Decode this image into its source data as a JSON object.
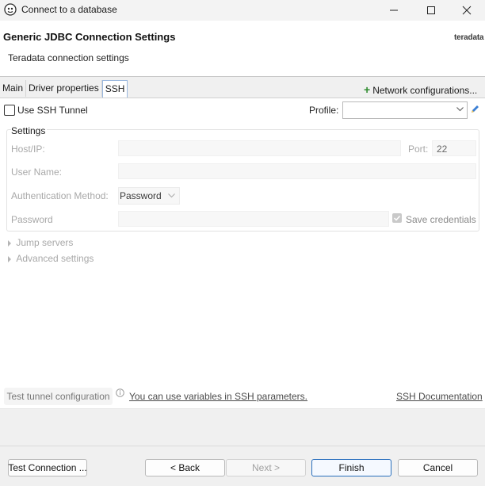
{
  "window": {
    "title": "Connect to a database",
    "minimize_icon": "minimize-icon",
    "maximize_icon": "maximize-icon",
    "close_icon": "close-icon",
    "app_icon": "dbeaver-icon"
  },
  "header": {
    "title": "Generic JDBC Connection Settings",
    "subtitle": "Teradata connection settings",
    "brand": "teradata"
  },
  "tabs": [
    {
      "label": "Main",
      "active": false
    },
    {
      "label": "Driver properties",
      "active": false
    },
    {
      "label": "SSH",
      "active": true
    }
  ],
  "network_config": {
    "label": "Network configurations...",
    "icon": "plus-icon"
  },
  "ssh": {
    "use_tunnel_label": "Use SSH Tunnel",
    "use_tunnel_checked": false,
    "profile_label": "Profile:",
    "profile_value": "",
    "edit_icon": "pencil-icon"
  },
  "settings": {
    "group_title": "Settings",
    "host_label": "Host/IP:",
    "host_value": "",
    "port_label": "Port:",
    "port_value": "22",
    "user_label": "User Name:",
    "user_value": "",
    "auth_label": "Authentication Method:",
    "auth_value": "Password",
    "password_label": "Password",
    "password_value": "",
    "save_credentials_label": "Save credentials",
    "save_credentials_checked": true
  },
  "sections": {
    "jump_servers": "Jump servers",
    "advanced": "Advanced settings"
  },
  "footer_links": {
    "test_tunnel": "Test tunnel configuration",
    "variables_hint": "You can use variables in SSH parameters.",
    "info_icon": "info-icon",
    "docs": "SSH Documentation"
  },
  "buttons": {
    "test_connection": "Test Connection ...",
    "back": "< Back",
    "next": "Next >",
    "finish": "Finish",
    "cancel": "Cancel"
  },
  "colors": {
    "accent_blue": "#2a6fbd",
    "plus_green": "#2e8b2e",
    "disabled_text": "#a8a8a8"
  }
}
